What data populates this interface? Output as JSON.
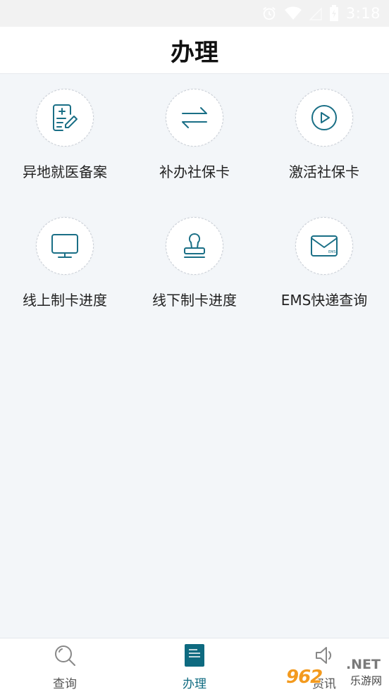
{
  "status_bar": {
    "time": "3:18",
    "icons": [
      "alarm-icon",
      "wifi-icon",
      "signal-icon",
      "battery-icon"
    ]
  },
  "header": {
    "title": "办理"
  },
  "services": [
    {
      "label": "异地就医备案",
      "icon": "medical-record-icon"
    },
    {
      "label": "补办社保卡",
      "icon": "swap-arrows-icon"
    },
    {
      "label": "激活社保卡",
      "icon": "play-circle-icon"
    },
    {
      "label": "线上制卡进度",
      "icon": "monitor-icon"
    },
    {
      "label": "线下制卡进度",
      "icon": "stamp-icon"
    },
    {
      "label": "EMS快递查询",
      "icon": "ems-envelope-icon"
    }
  ],
  "tabbar": {
    "active_index": 1,
    "tabs": [
      {
        "label": "查询",
        "icon": "search-icon"
      },
      {
        "label": "办理",
        "icon": "document-icon"
      },
      {
        "label": "资讯",
        "icon": "speaker-icon"
      }
    ]
  },
  "watermark": {
    "logo": "962",
    "net": ".NET",
    "sub": "乐游网"
  },
  "colors": {
    "accent": "#0e6a80",
    "background": "#f3f6f9",
    "icon_stroke": "#1a6f86"
  }
}
